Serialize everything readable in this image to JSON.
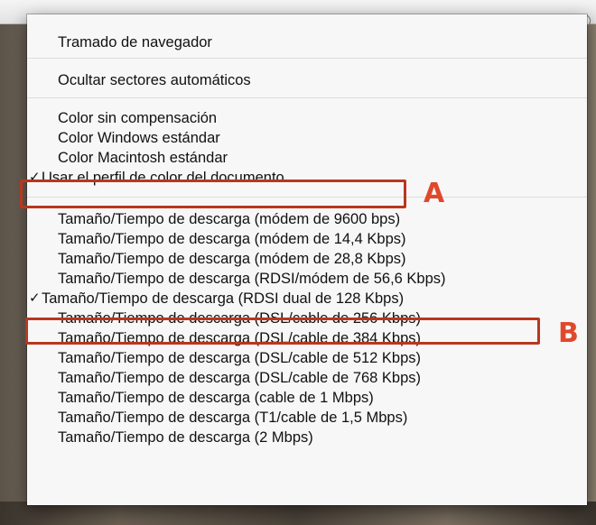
{
  "menu": {
    "items": [
      {
        "label": "Tramado de navegador",
        "checked": false
      },
      {
        "label": "Ocultar sectores automáticos",
        "checked": false
      },
      {
        "label": "Color sin compensación",
        "checked": false
      },
      {
        "label": "Color Windows estándar",
        "checked": false
      },
      {
        "label": "Color Macintosh estándar",
        "checked": false
      },
      {
        "label": "Usar el perfil de color del documento",
        "checked": true
      },
      {
        "label": "Tamaño/Tiempo de descarga (módem de 9600 bps)",
        "checked": false
      },
      {
        "label": "Tamaño/Tiempo de descarga (módem de 14,4 Kbps)",
        "checked": false
      },
      {
        "label": "Tamaño/Tiempo de descarga (módem de 28,8 Kbps)",
        "checked": false
      },
      {
        "label": "Tamaño/Tiempo de descarga (RDSI/módem de 56,6 Kbps)",
        "checked": false
      },
      {
        "label": "Tamaño/Tiempo de descarga (RDSI dual de 128 Kbps)",
        "checked": true
      },
      {
        "label": "Tamaño/Tiempo de descarga (DSL/cable de 256 Kbps)",
        "checked": false
      },
      {
        "label": "Tamaño/Tiempo de descarga (DSL/cable de 384 Kbps)",
        "checked": false
      },
      {
        "label": "Tamaño/Tiempo de descarga (DSL/cable de 512 Kbps)",
        "checked": false
      },
      {
        "label": "Tamaño/Tiempo de descarga (DSL/cable de 768 Kbps)",
        "checked": false
      },
      {
        "label": "Tamaño/Tiempo de descarga (cable de 1 Mbps)",
        "checked": false
      },
      {
        "label": "Tamaño/Tiempo de descarga (T1/cable de 1,5 Mbps)",
        "checked": false
      },
      {
        "label": "Tamaño/Tiempo de descarga (2 Mbps)",
        "checked": false
      }
    ],
    "check_glyph": "✓"
  },
  "annotations": {
    "a_label": "A",
    "b_label": "B",
    "color": "#b8371f"
  },
  "icons": {
    "flyout": "flyout-menu-icon",
    "checkmark": "checkmark-icon"
  }
}
